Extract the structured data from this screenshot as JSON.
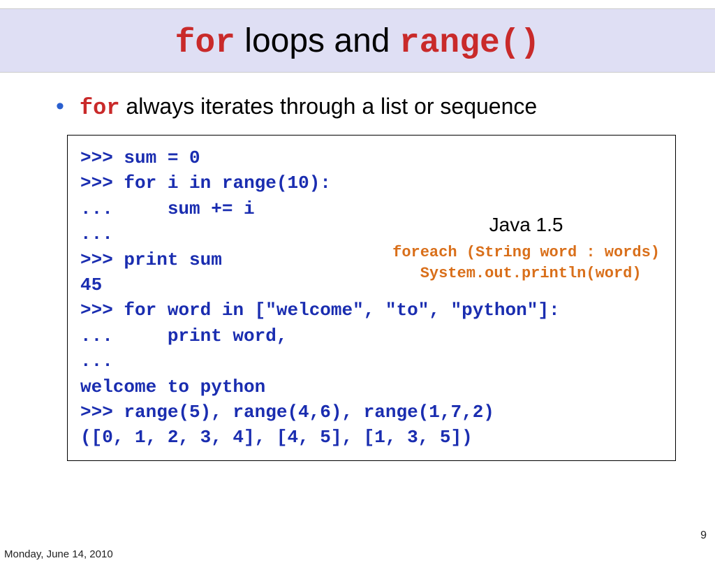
{
  "title": {
    "part1": "for",
    "part2": " loops and ",
    "part3": "range()"
  },
  "bullet": {
    "code": "for",
    "text": " always iterates through a list or sequence"
  },
  "code": {
    "l1": ">>> sum = 0",
    "l2a": ">>> ",
    "l2b": "for",
    "l2c": " i ",
    "l2d": "in",
    "l2e": " range(10):",
    "l3": "...     sum += i",
    "l4": "... ",
    "l5": ">>> print sum",
    "l6": "45",
    "l7": "",
    "l8a": ">>> ",
    "l8b": "for",
    "l8c": " word ",
    "l8d": "in",
    "l8e": " [\"welcome\", \"to\", \"python\"]:",
    "l9": "...     print word,",
    "l10": "... ",
    "l11": "welcome to python",
    "l12": "",
    "l13": ">>> range(5), range(4,6), range(1,7,2)",
    "l14": "([0, 1, 2, 3, 4], [4, 5], [1, 3, 5])"
  },
  "java": {
    "title": "Java 1.5",
    "line1": "foreach (String word : words)",
    "line2": "   System.out.println(word)"
  },
  "page_number": "9",
  "date": "Monday, June 14, 2010"
}
